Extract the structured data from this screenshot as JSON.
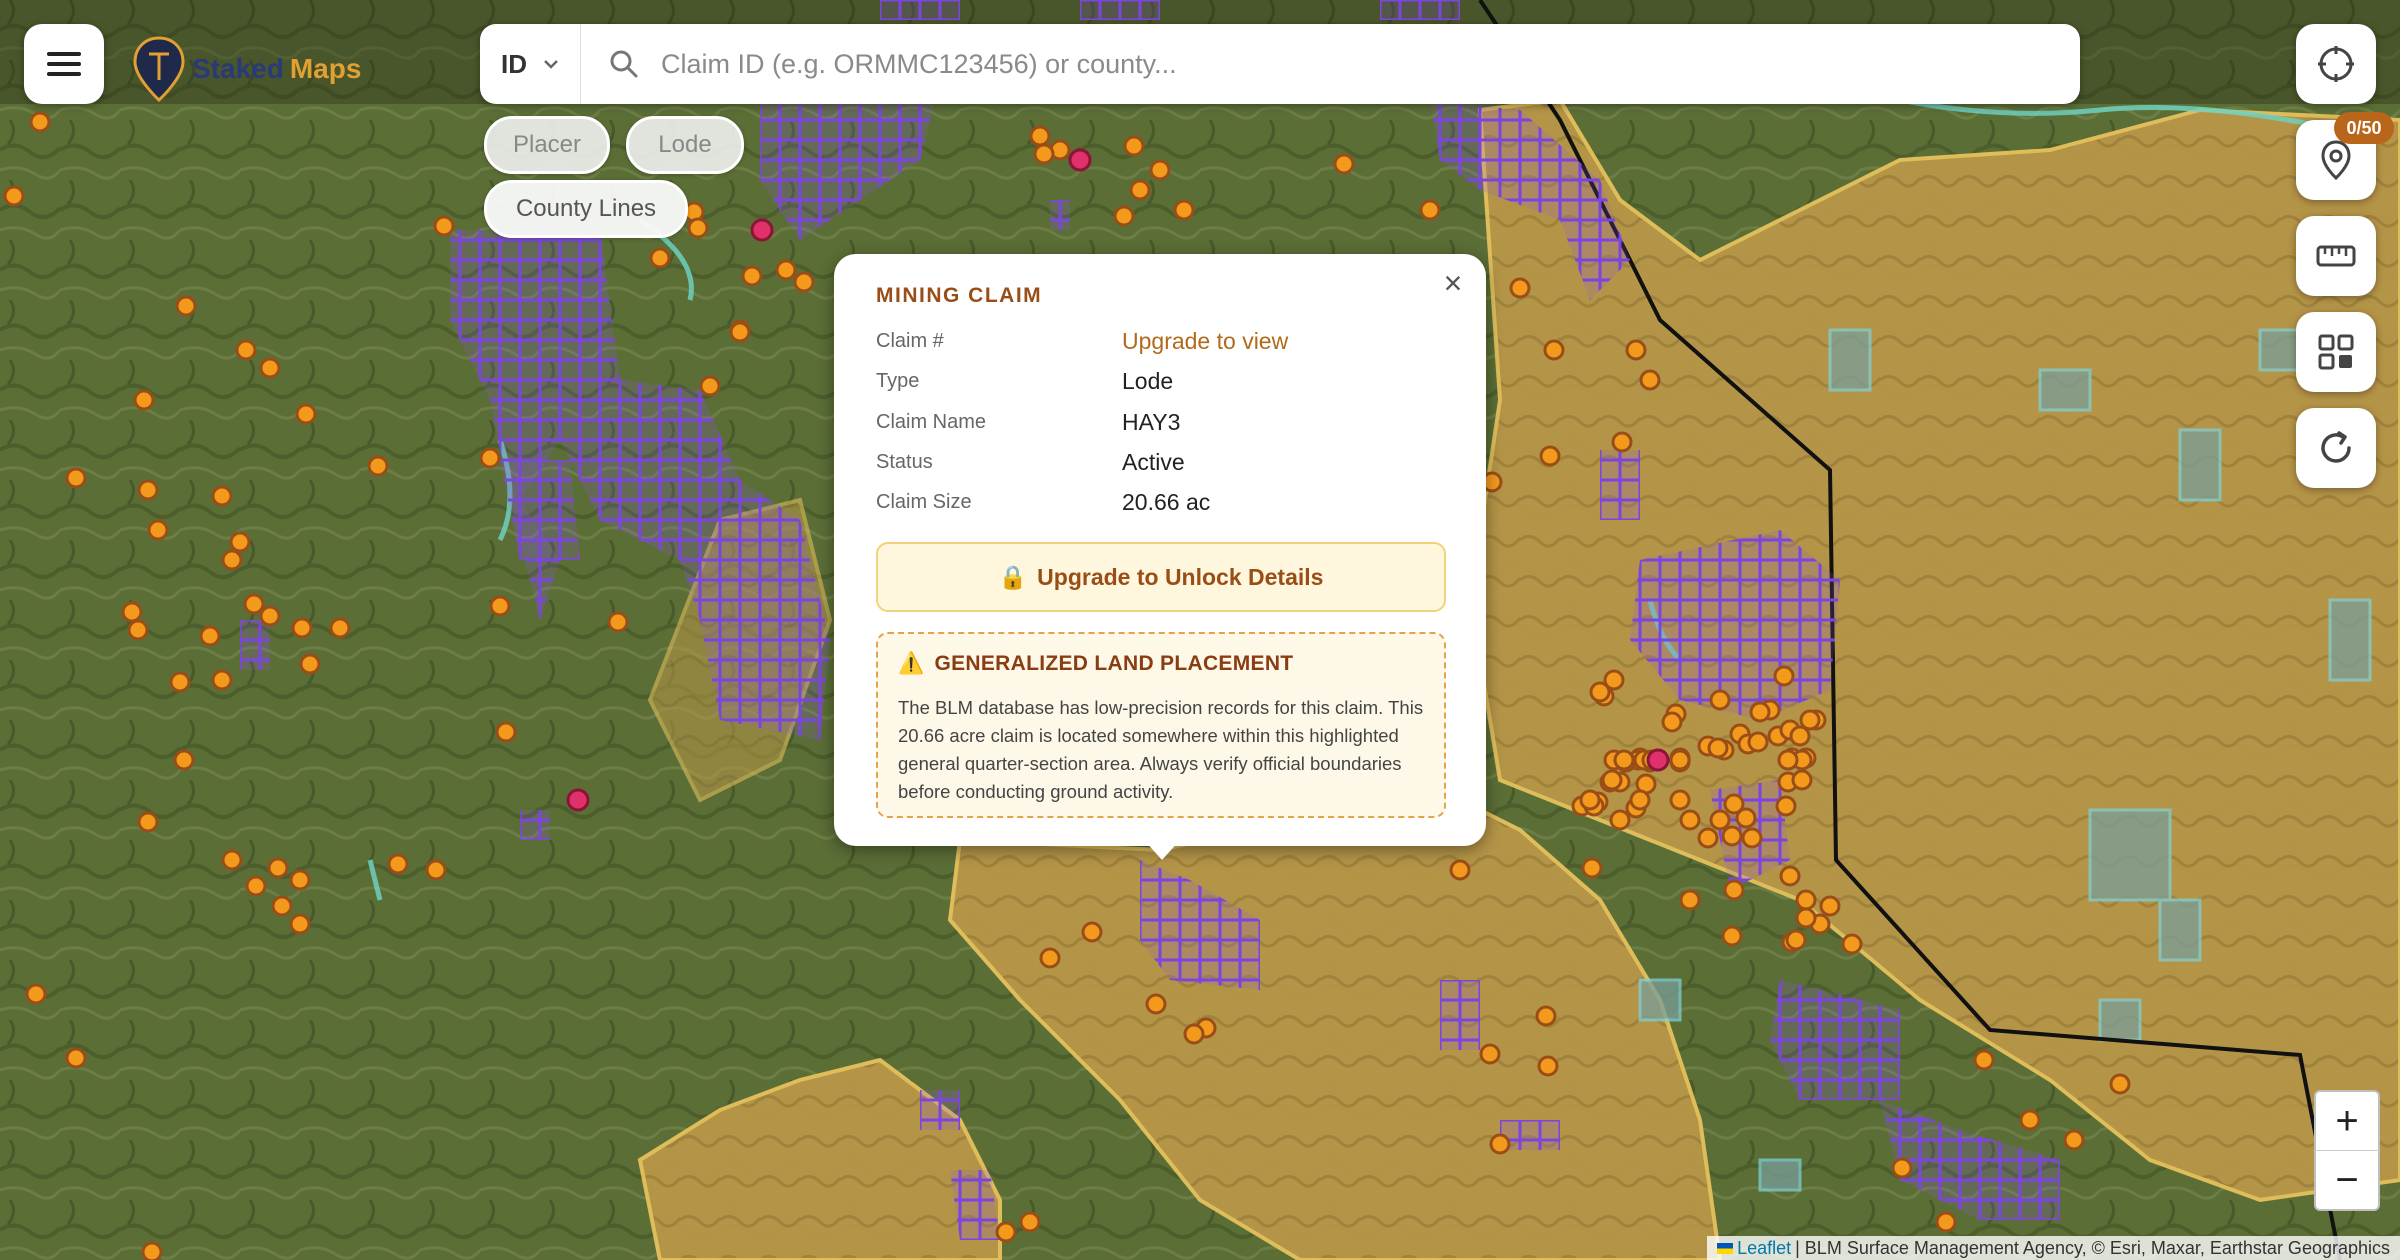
{
  "app": {
    "brand_part1": "Staked",
    "brand_part2": "Maps"
  },
  "colors": {
    "claim_purple": "#7d45e0",
    "claim_point_orange": "#f39a1d",
    "claim_point_red": "#e0316a",
    "blm_yellow": "#d9b45a",
    "boundary": "#111111",
    "accent_brown": "#9a4e17"
  },
  "search": {
    "state_value": "ID",
    "placeholder": "Claim ID (e.g. ORMMC123456) or county..."
  },
  "filters": [
    {
      "label": "Placer",
      "active": false
    },
    {
      "label": "Lode",
      "active": false
    },
    {
      "label": "County Lines",
      "active": true
    }
  ],
  "toolbar": {
    "pin_counter": "0/50",
    "icons": [
      "crosshair-icon",
      "map-pin-icon",
      "ruler-icon",
      "grid-icon",
      "refresh-icon"
    ]
  },
  "popup": {
    "title": "MINING CLAIM",
    "rows": [
      {
        "label": "Claim #",
        "value": "Upgrade to view"
      },
      {
        "label": "Type",
        "value": "Lode"
      },
      {
        "label": "Claim Name",
        "value": "HAY3"
      },
      {
        "label": "Status",
        "value": "Active"
      },
      {
        "label": "Claim Size",
        "value": "20.66 ac"
      }
    ],
    "upgrade_label": "Upgrade to Unlock Details",
    "warning_title": "GENERALIZED LAND PLACEMENT",
    "warning_text": "The BLM database has low-precision records for this claim. This 20.66 acre claim is located somewhere within this highlighted general quarter-section area. Always verify official boundaries before conducting ground activity."
  },
  "zoom": {
    "in_label": "+",
    "out_label": "−"
  },
  "attribution": {
    "leaflet": "Leaflet",
    "text": "| BLM Surface Management Agency, © Esri, Maxar, Earthstar Geographics"
  }
}
